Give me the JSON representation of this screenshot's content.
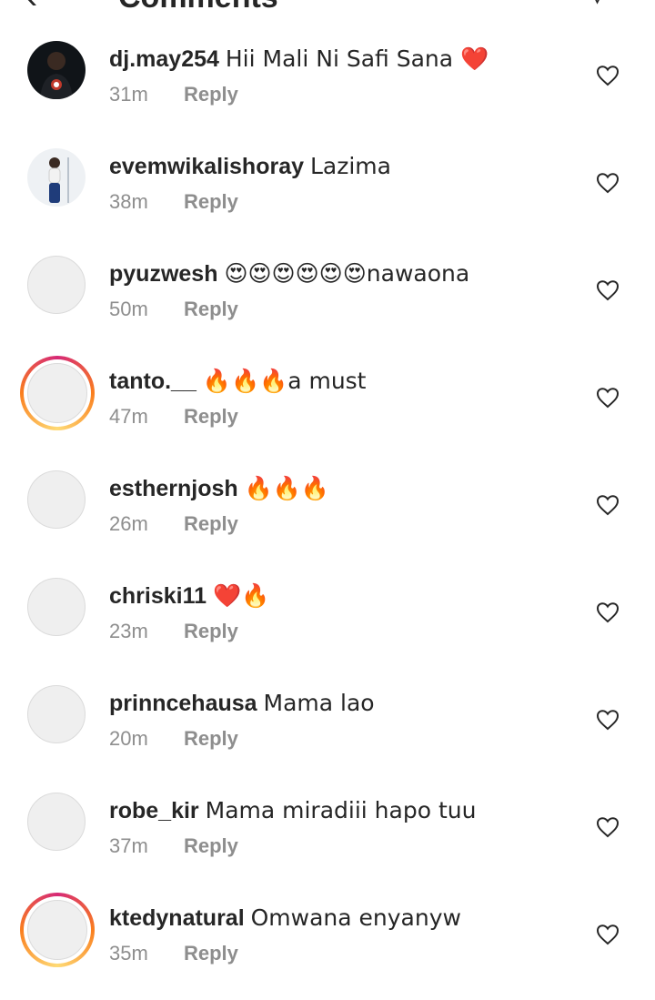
{
  "header": {
    "title": "Comments"
  },
  "comments": [
    {
      "username": "dj.may254",
      "text": "Hii Mali Ni Safi Sana ❤️",
      "time": "31m",
      "reply": "Reply",
      "avatar": "photo-dark",
      "ring": false
    },
    {
      "username": "evemwikalishoray",
      "text": "Lazima",
      "time": "38m",
      "reply": "Reply",
      "avatar": "photo-light",
      "ring": false
    },
    {
      "username": "pyuzwesh",
      "text": "😍😍😍😍😍😍nawaona",
      "time": "50m",
      "reply": "Reply",
      "avatar": "default",
      "ring": false
    },
    {
      "username": "tanto.__",
      "text": "🔥🔥🔥a must",
      "time": "47m",
      "reply": "Reply",
      "avatar": "default",
      "ring": true
    },
    {
      "username": "esthernjosh",
      "text": "🔥🔥🔥",
      "time": "26m",
      "reply": "Reply",
      "avatar": "default",
      "ring": false
    },
    {
      "username": "chriski11",
      "text": "❤️🔥",
      "time": "23m",
      "reply": "Reply",
      "avatar": "default",
      "ring": false
    },
    {
      "username": "prinncehausa",
      "text": "Mama lao",
      "time": "20m",
      "reply": "Reply",
      "avatar": "default",
      "ring": false
    },
    {
      "username": "robe_kir",
      "text": "Mama miradiii hapo tuu",
      "time": "37m",
      "reply": "Reply",
      "avatar": "default",
      "ring": false
    },
    {
      "username": "ktedynatural",
      "text": "Omwana enyanyw",
      "time": "35m",
      "reply": "Reply",
      "avatar": "default",
      "ring": true
    }
  ],
  "icons": {
    "like": "heart-outline-icon",
    "back": "back-arrow-icon",
    "send": "send-icon"
  }
}
